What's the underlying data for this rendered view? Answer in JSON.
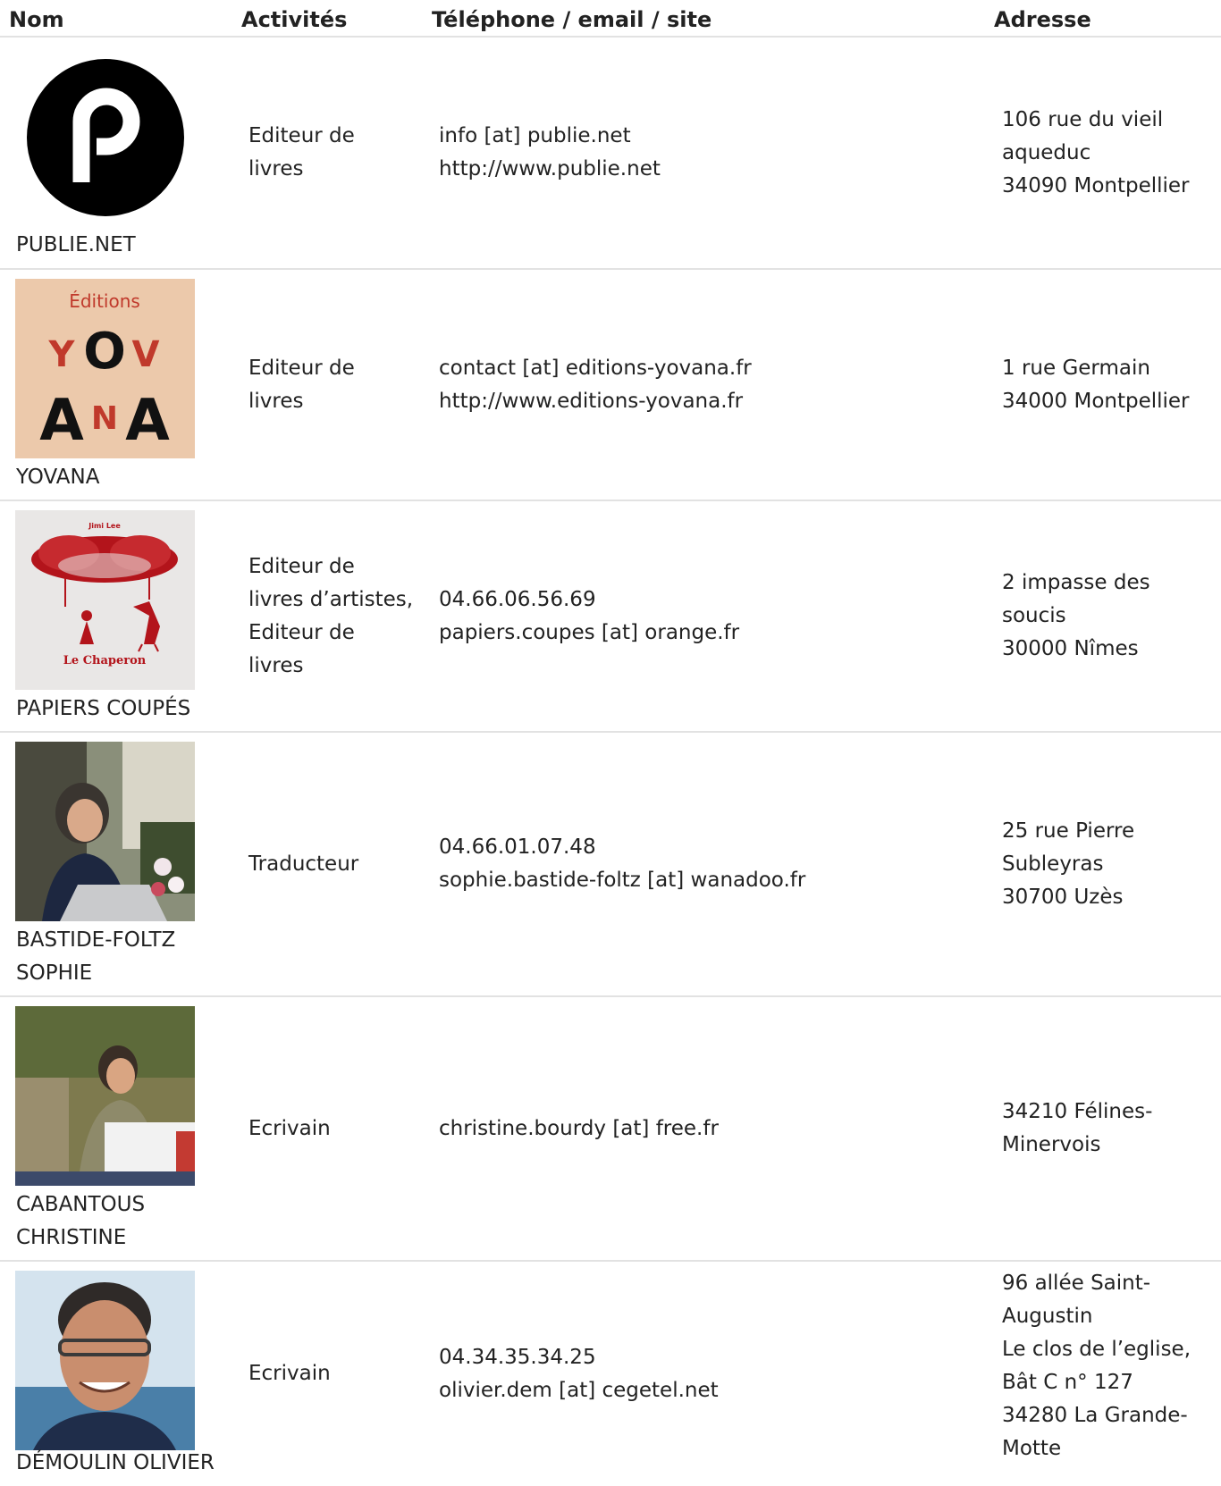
{
  "table": {
    "headers": [
      "Nom",
      "Activités",
      "Téléphone / email / site",
      "Adresse"
    ],
    "rows": [
      {
        "name_lines": [
          "PUBLIE.NET"
        ],
        "image": "publie-net-logo",
        "activity_lines": [
          "Editeur de",
          "livres"
        ],
        "contact_lines": [
          "info [at] publie.net",
          "http://www.publie.net"
        ],
        "address_lines": [
          "106 rue du vieil",
          "aqueduc",
          "34090 Montpellier"
        ]
      },
      {
        "name_lines": [
          "YOVANA"
        ],
        "image": "yovana-logo",
        "logo_text": {
          "top": "Éditions",
          "row1": [
            "Y",
            "O",
            "V"
          ],
          "row2": [
            "A",
            "N",
            "A"
          ]
        },
        "activity_lines": [
          "Editeur de",
          "livres"
        ],
        "contact_lines": [
          "contact [at] editions-yovana.fr",
          "http://www.editions-yovana.fr"
        ],
        "address_lines": [
          "1 rue Germain",
          "34000 Montpellier"
        ]
      },
      {
        "name_lines": [
          "PAPIERS COUPÉS"
        ],
        "image": "papiers-coupes-book-cover",
        "cover_text": {
          "author": "Jimi Lee",
          "title": "Le Chaperon"
        },
        "activity_lines": [
          "Editeur de",
          "livres d’artistes,",
          "Editeur de",
          "livres"
        ],
        "contact_lines": [
          "04.66.06.56.69",
          "papiers.coupes [at] orange.fr"
        ],
        "address_lines": [
          "2 impasse des",
          "soucis",
          "30000 Nîmes"
        ]
      },
      {
        "name_lines": [
          "BASTIDE-FOLTZ",
          "SOPHIE"
        ],
        "image": "portrait-photo",
        "activity_lines": [
          "Traducteur"
        ],
        "contact_lines": [
          "04.66.01.07.48",
          "sophie.bastide-foltz [at] wanadoo.fr"
        ],
        "address_lines": [
          "25 rue Pierre",
          "Subleyras",
          "30700 Uzès"
        ]
      },
      {
        "name_lines": [
          "CABANTOUS",
          "CHRISTINE"
        ],
        "image": "portrait-photo",
        "activity_lines": [
          "Ecrivain"
        ],
        "contact_lines": [
          "christine.bourdy [at] free.fr"
        ],
        "address_lines": [
          "34210 Félines-",
          "Minervois"
        ]
      },
      {
        "name_lines": [
          "DÉMOULIN OLIVIER"
        ],
        "image": "portrait-photo",
        "activity_lines": [
          "Ecrivain"
        ],
        "contact_lines": [
          "04.34.35.34.25",
          "olivier.dem [at] cegetel.net"
        ],
        "address_lines": [
          "96 allée Saint-",
          "Augustin",
          "Le clos de l’eglise,",
          "Bât C n° 127",
          "34280 La Grande-",
          "Motte"
        ]
      }
    ]
  },
  "colors": {
    "text": "#222222",
    "border": "#e2e2e2",
    "yovana_bg": "#ecc9ab",
    "yovana_accent": "#c0392b",
    "chaperon_red": "#b3141b"
  }
}
